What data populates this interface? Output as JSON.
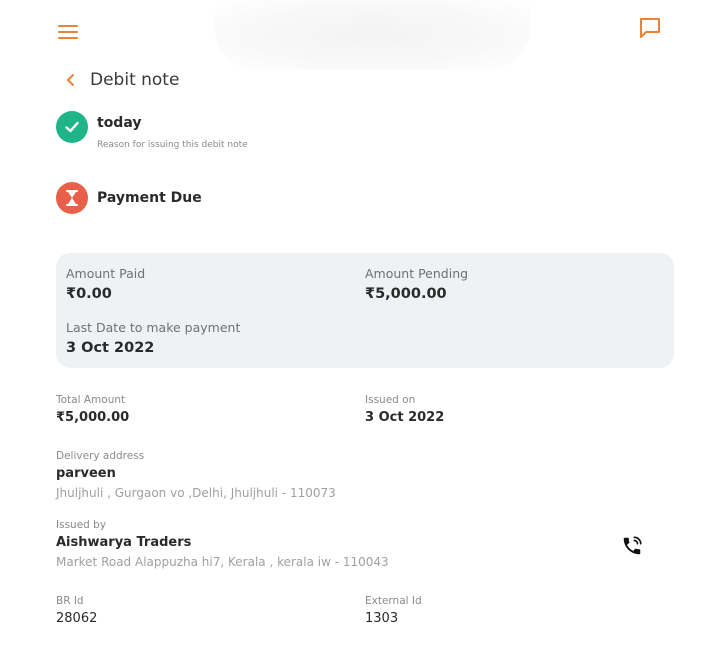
{
  "colors": {
    "accent": "#e8833a",
    "success": "#1fb489",
    "danger": "#e8604a",
    "card_bg": "#eef2f5"
  },
  "header": {
    "menu_icon": "hamburger-icon",
    "chat_icon": "chat-icon"
  },
  "page": {
    "back_icon": "chevron-left-icon",
    "title": "Debit note"
  },
  "status": [
    {
      "icon": "check-icon",
      "title": "today",
      "subtitle": "Reason for issuing this debit note"
    },
    {
      "icon": "hourglass-icon",
      "title": "Payment Due"
    }
  ],
  "amounts": {
    "paid_label": "Amount Paid",
    "paid_value": "₹0.00",
    "pending_label": "Amount Pending",
    "pending_value": "₹5,000.00",
    "last_date_label": "Last Date to make payment",
    "last_date_value": "3 Oct 2022"
  },
  "details": {
    "total_label": "Total Amount",
    "total_value": "₹5,000.00",
    "issued_on_label": "Issued on",
    "issued_on_value": "3 Oct 2022",
    "delivery_label": "Delivery address",
    "delivery_name": "parveen",
    "delivery_address": "Jhuljhuli , Gurgaon vo ,Delhi, Jhuljhuli - 110073",
    "issued_by_label": "Issued by",
    "issued_by_name": "Aishwarya Traders",
    "issued_by_address": "Market Road Alappuzha hi7, Kerala , kerala iw - 110043",
    "phone_icon": "phone-call-icon",
    "br_label": "BR Id",
    "br_value": "28062",
    "external_label": "External Id",
    "external_value": "1303"
  }
}
